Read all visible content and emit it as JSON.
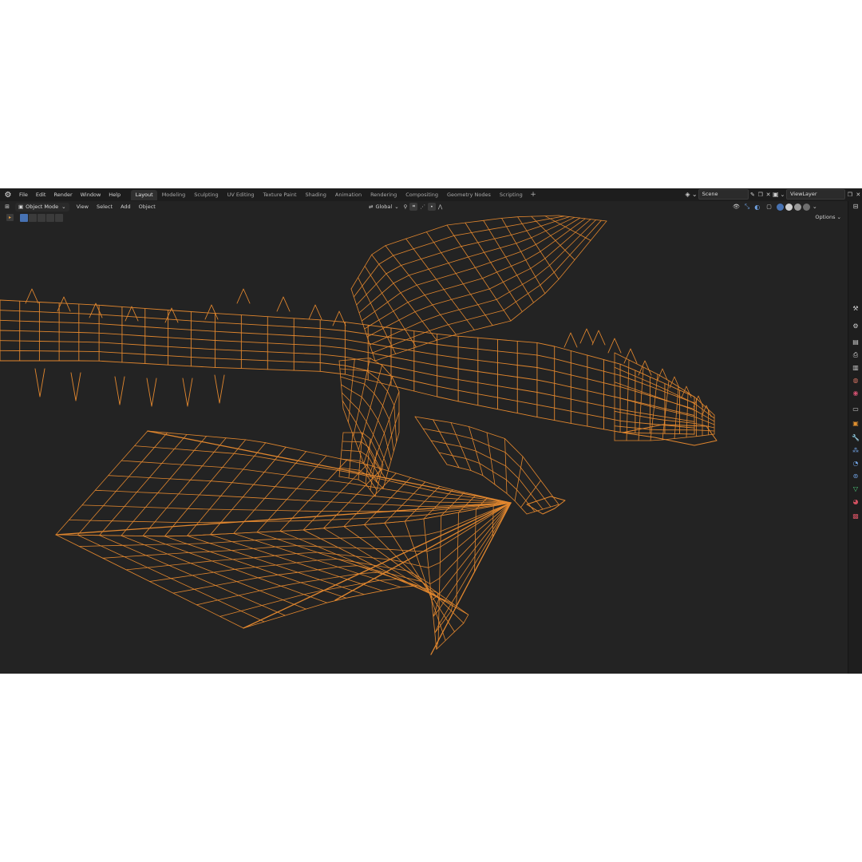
{
  "menu": [
    "File",
    "Edit",
    "Render",
    "Window",
    "Help"
  ],
  "workspaces": [
    "Layout",
    "Modeling",
    "Sculpting",
    "UV Editing",
    "Texture Paint",
    "Shading",
    "Animation",
    "Rendering",
    "Compositing",
    "Geometry Nodes",
    "Scripting"
  ],
  "active_workspace": "Layout",
  "scene_name": "Scene",
  "view_layer": "ViewLayer",
  "header": {
    "mode": "Object Mode",
    "view": "View",
    "select": "Select",
    "add": "Add",
    "object": "Object",
    "transform_orientation": "Global",
    "options": "Options"
  },
  "colors": {
    "wire": "#e0862e",
    "background": "#232323",
    "accent": "#4772b3"
  },
  "icons": {
    "logo": "blender-logo-icon",
    "editor_type": "viewport-editor-icon",
    "snap": "snap-icon",
    "proportional": "proportional-editing-icon",
    "overlay": "overlay-icon",
    "xray": "xray-icon"
  }
}
